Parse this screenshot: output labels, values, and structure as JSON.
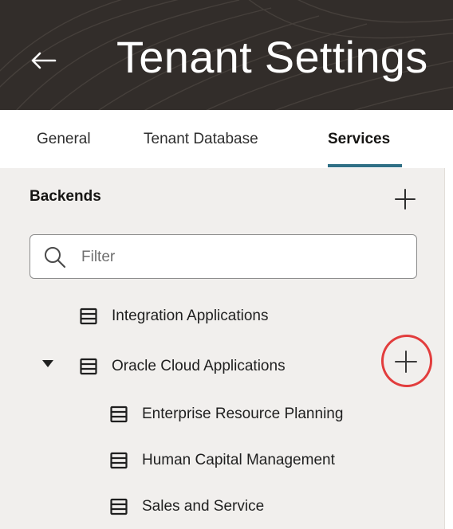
{
  "header": {
    "title": "Tenant Settings",
    "back_icon": "arrow-left-icon",
    "background": "#322d2a"
  },
  "tabs": [
    {
      "label": "General",
      "active": false
    },
    {
      "label": "Tenant Database",
      "active": false
    },
    {
      "label": "Services",
      "active": true
    }
  ],
  "accent_color": "#2f6f85",
  "sidebar": {
    "title": "Backends",
    "add_icon": "plus-icon",
    "filter": {
      "placeholder": "Filter",
      "value": "",
      "icon": "search-icon"
    },
    "tree": [
      {
        "label": "Integration Applications",
        "icon": "server-icon"
      },
      {
        "label": "Oracle Cloud Applications",
        "icon": "server-icon",
        "expanded": true,
        "add_icon": "plus-icon",
        "children": [
          {
            "label": "Enterprise Resource Planning",
            "icon": "server-icon"
          },
          {
            "label": "Human Capital Management",
            "icon": "server-icon"
          },
          {
            "label": "Sales and Service",
            "icon": "server-icon"
          }
        ]
      }
    ],
    "highlight_color": "#e23d3d"
  }
}
